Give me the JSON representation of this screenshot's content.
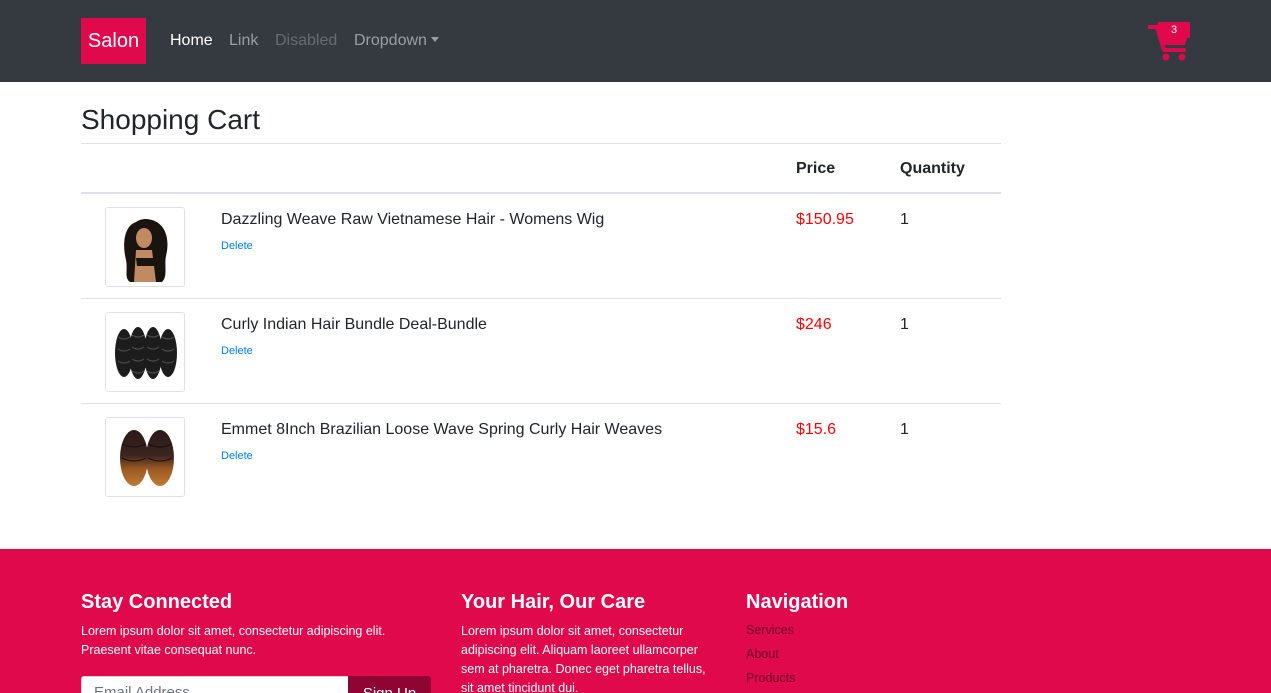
{
  "navbar": {
    "brand": "Salon",
    "links": [
      "Home",
      "Link",
      "Disabled",
      "Dropdown"
    ],
    "cart_count": "3"
  },
  "cart": {
    "title": "Shopping Cart",
    "headers": {
      "price": "Price",
      "quantity": "Quantity"
    },
    "items": [
      {
        "name": "Dazzling Weave Raw Vietnamese Hair - Womens Wig",
        "action": "Delete",
        "price": "$150.95",
        "quantity": "1"
      },
      {
        "name": "Curly Indian Hair Bundle Deal-Bundle",
        "action": "Delete",
        "price": "$246",
        "quantity": "1"
      },
      {
        "name": "Emmet 8Inch Brazilian Loose Wave Spring Curly Hair Weaves",
        "action": "Delete",
        "price": "$15.6",
        "quantity": "1"
      }
    ]
  },
  "footer": {
    "col1": {
      "title": "Stay Connected",
      "text": "Lorem ipsum dolor sit amet, consectetur adipiscing elit. Praesent vitae consequat nunc.",
      "email_placeholder": "Email Address",
      "signup": "Sign Up"
    },
    "col2": {
      "title": "Your Hair, Our Care",
      "text": "Lorem ipsum dolor sit amet, consectetur adipiscing elit. Aliquam laoreet ullamcorper sem at pharetra. Donec eget pharetra tellus, sit amet tincidunt dui."
    },
    "col3": {
      "title": "Navigation",
      "links": [
        "Services",
        "About",
        "Products"
      ]
    }
  },
  "colors": {
    "brand": "#e0094b",
    "navbar": "#343a40",
    "price": "#ff0000",
    "link": "#007bff"
  }
}
